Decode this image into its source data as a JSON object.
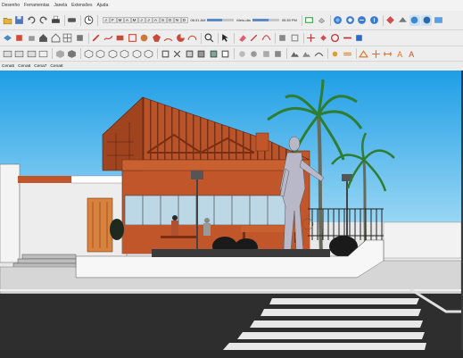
{
  "menu": [
    "Desenho",
    "Ferramentas",
    "Janela",
    "Extensões",
    "Ajuda"
  ],
  "shadow": {
    "months": [
      "J",
      "F",
      "M",
      "A",
      "M",
      "J",
      "J",
      "A",
      "S",
      "O",
      "N",
      "D"
    ],
    "time_start": "06:31 AM",
    "time_mid": "Meio-dia",
    "time_end": "05:35 PM",
    "slider_level": 0.55
  },
  "tabs": [
    "Cena5",
    "Cena6",
    "Cena7",
    "Cena8"
  ],
  "toolbar1_icons": [
    "open-icon",
    "save-icon",
    "undo-icon",
    "redo-icon",
    "print-icon",
    "sep",
    "erase-icon",
    "sep",
    "clock-icon",
    "sep",
    "sep",
    "sep",
    "sep",
    "sep",
    "sep",
    "styles-icon",
    "sep",
    "warehouse-icon",
    "extension-icon",
    "layout-icon",
    "sep",
    "orbit-icon",
    "section-icon",
    "scene-icon",
    "sep",
    "sandbox-icon"
  ],
  "toolbar2_icons": [
    "select-icon",
    "paint-icon",
    "component-icon",
    "home-icon",
    "house-outline-icon",
    "grid-icon",
    "sep",
    "pencil-icon",
    "freehand-icon",
    "rectangle-icon",
    "rotated-rect-icon",
    "circle-icon",
    "polygon-icon",
    "arc-icon",
    "pie-icon",
    "arc2-icon",
    "sep",
    "zoom-icon",
    "sep",
    "arrow-select-icon",
    "sep",
    "eraser-icon",
    "sep",
    "pen-icon",
    "arc-tool-icon",
    "sep",
    "shape-icon",
    "sep",
    "move-icon",
    "push-icon",
    "rotate-icon",
    "follow-icon",
    "scale-icon"
  ],
  "toolbar3_icons": [
    "views-icon",
    "camera-icon",
    "walk-icon",
    "face-icon",
    "sep",
    "section-plane-icon",
    "sep",
    "iso-icon",
    "top-icon",
    "front-icon",
    "right-icon",
    "back-icon",
    "left-icon",
    "sep",
    "xray-icon",
    "wire-icon",
    "hidden-icon",
    "shaded-icon",
    "textured-icon",
    "mono-icon",
    "sep",
    "solid-union-icon",
    "solid-sub-icon",
    "solid-trim-icon",
    "solid-split-icon",
    "sep",
    "terrain-icon",
    "stamp-icon",
    "drape-icon",
    "sep",
    "sun-icon",
    "fog-icon",
    "sep",
    "protractor-icon",
    "axes-icon",
    "dimension-icon",
    "text-icon",
    "text3d-icon"
  ],
  "colors": {
    "sky_top": "#2aa8e8",
    "sky_bottom": "#9ed8f4",
    "wall": "#c0562a",
    "roof": "#8a3a1a",
    "road": "#2b2b2b",
    "sidewalk": "#d8d8d8",
    "palm": "#3a8a3a"
  }
}
